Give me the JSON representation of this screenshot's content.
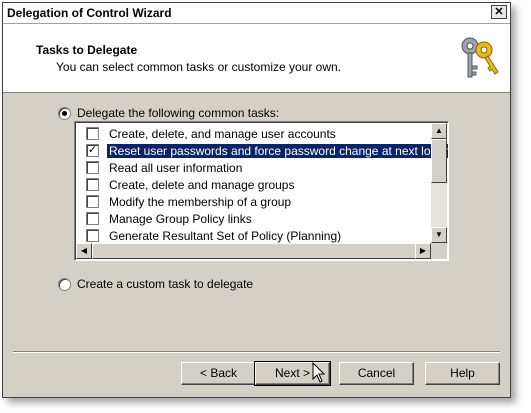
{
  "window": {
    "title": "Delegation of Control Wizard",
    "close_glyph": "✕"
  },
  "header": {
    "title": "Tasks to Delegate",
    "subtitle": "You can select common tasks or customize your own.",
    "icon": "keys-icon"
  },
  "options": {
    "common_tasks_label": "Delegate the following common tasks:",
    "common_tasks_selected": true,
    "custom_task_label": "Create a custom task to delegate",
    "custom_task_selected": false
  },
  "tasks": [
    {
      "label": "Create, delete, and manage user accounts",
      "checked": false,
      "selected": false
    },
    {
      "label": "Reset user passwords and force password change at next logon",
      "checked": true,
      "selected": true
    },
    {
      "label": "Read all user information",
      "checked": false,
      "selected": false
    },
    {
      "label": "Create, delete and manage groups",
      "checked": false,
      "selected": false
    },
    {
      "label": "Modify the membership of a group",
      "checked": false,
      "selected": false
    },
    {
      "label": "Manage Group Policy links",
      "checked": false,
      "selected": false
    },
    {
      "label": "Generate Resultant Set of Policy (Planning)",
      "checked": false,
      "selected": false
    }
  ],
  "buttons": {
    "back": "< Back",
    "next": "Next >",
    "cancel": "Cancel",
    "help": "Help"
  },
  "colors": {
    "dialog_bg": "#d4d0c8",
    "selection": "#0a246a"
  }
}
